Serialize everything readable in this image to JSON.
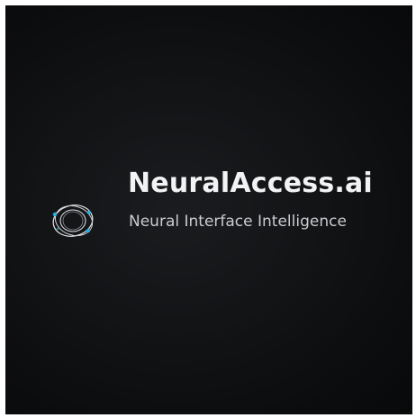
{
  "brand": {
    "name": "NeuralAccess.ai",
    "tagline": "Neural Interface Intelligence"
  },
  "logo": {
    "icon": "orbit-ring-logo-icon",
    "accent_color": "#2ab0e6",
    "ring_color": "#e9eaec"
  },
  "colors": {
    "background": "#111214",
    "frame": "#ffffff",
    "title": "#f2f3f5",
    "tagline": "#c9cbcf"
  }
}
